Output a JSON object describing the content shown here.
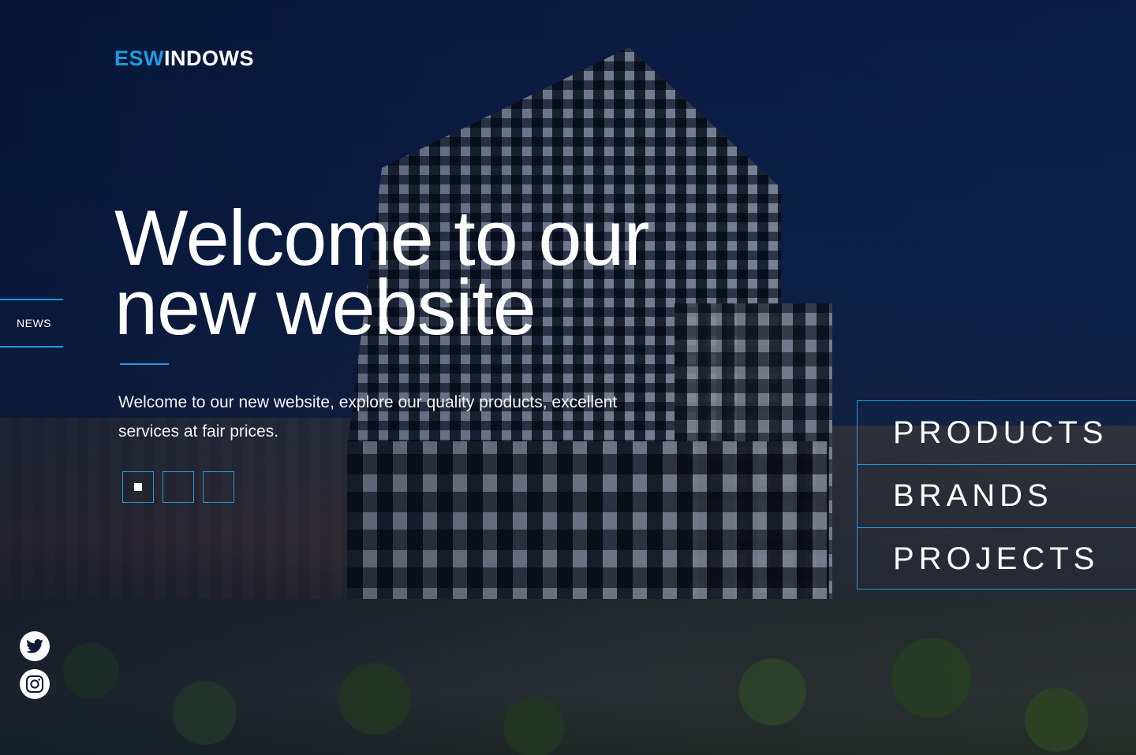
{
  "logo": {
    "accent": "ESW",
    "rest": "INDOWS"
  },
  "hero": {
    "title_line1": "Welcome to our",
    "title_line2": "new website",
    "subtitle": "Welcome to our new website, explore our quality products, excellent services at fair prices."
  },
  "slider": {
    "count": 3,
    "active_index": 0
  },
  "news_tab": {
    "label": "NEWS"
  },
  "side_nav": {
    "items": [
      {
        "label": "PRODUCTS"
      },
      {
        "label": "BRANDS"
      },
      {
        "label": "PROJECTS"
      }
    ]
  },
  "social": {
    "icons": [
      "twitter-icon",
      "instagram-icon"
    ]
  },
  "colors": {
    "accent": "#1e9be0",
    "text": "#ffffff",
    "background": "#0c1a3a"
  }
}
